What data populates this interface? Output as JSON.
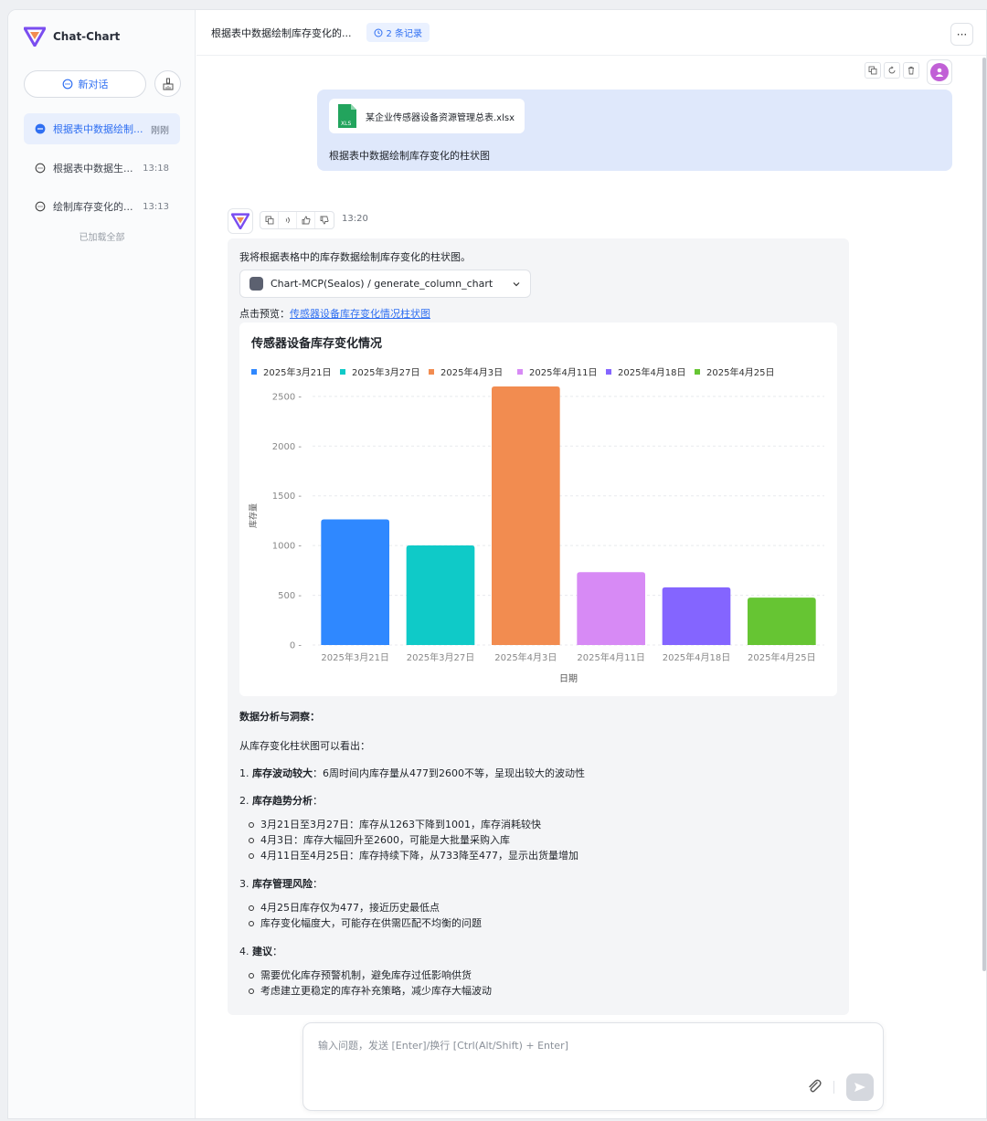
{
  "app": {
    "name": "Chat-Chart"
  },
  "sidebar": {
    "new_chat_label": "新对话",
    "history": [
      {
        "title": "根据表中数据绘制...",
        "time": "刚刚",
        "active": true
      },
      {
        "title": "根据表中数据生...",
        "time": "13:18",
        "active": false
      },
      {
        "title": "绘制库存变化的...",
        "time": "13:13",
        "active": false
      }
    ],
    "loaded_all": "已加载全部"
  },
  "header": {
    "title": "根据表中数据绘制库存变化的...",
    "records": "2 条记录"
  },
  "user_message": {
    "file_name": "某企业传感器设备资源管理总表.xlsx",
    "file_type": "XLS",
    "text": "根据表中数据绘制库存变化的柱状图"
  },
  "ai_message": {
    "time": "13:20",
    "intro": "我将根据表格中的库存数据绘制库存变化的柱状图。",
    "tool_call": "Chart-MCP(Sealos) / generate_column_chart",
    "preview_label": "点击预览：",
    "preview_link": "传感器设备库存变化情况柱状图",
    "analysis": {
      "heading": "数据分析与洞察：",
      "intro": "从库存变化柱状图可以看出：",
      "s1_num": "1.",
      "s1_title": "库存波动较大",
      "s1_text": "：6周时间内库存量从477到2600不等，呈现出较大的波动性",
      "s2_num": "2.",
      "s2_title": "库存趋势分析",
      "s2_colon": "：",
      "s2_items": [
        "3月21日至3月27日：库存从1263下降到1001，库存消耗较快",
        "4月3日：库存大幅回升至2600，可能是大批量采购入库",
        "4月11日至4月25日：库存持续下降，从733降至477，显示出货量增加"
      ],
      "s3_num": "3.",
      "s3_title": "库存管理风险",
      "s3_colon": "：",
      "s3_items": [
        "4月25日库存仅为477，接近历史最低点",
        "库存变化幅度大，可能存在供需匹配不均衡的问题"
      ],
      "s4_num": "4.",
      "s4_title": "建议",
      "s4_colon": "：",
      "s4_items": [
        "需要优化库存预警机制，避免库存过低影响供货",
        "考虑建立更稳定的库存补充策略，减少库存大幅波动"
      ]
    }
  },
  "composer": {
    "placeholder": "输入问题，发送 [Enter]/换行 [Ctrl(Alt/Shift) + Enter]"
  },
  "colors": {
    "accent": "#2f6ff2",
    "user_bubble": "#dfe8fb"
  },
  "chart_data": {
    "type": "bar",
    "title": "传感器设备库存变化情况",
    "xlabel": "日期",
    "ylabel": "库存量",
    "categories": [
      "2025年3月21日",
      "2025年3月27日",
      "2025年4月3日",
      "2025年4月11日",
      "2025年4月18日",
      "2025年4月25日"
    ],
    "values": [
      1263,
      1001,
      2600,
      733,
      580,
      477
    ],
    "colors": [
      "#2f88ff",
      "#0fcac8",
      "#f28c50",
      "#d78af5",
      "#8465ff",
      "#66c533"
    ],
    "yticks": [
      0,
      500,
      1000,
      1500,
      2000,
      2500
    ],
    "ytick_labels": [
      "0",
      "500",
      "1000",
      "1500",
      "2000",
      "2500"
    ],
    "ylim": [
      0,
      2600
    ],
    "legend": "top",
    "grid": true
  }
}
